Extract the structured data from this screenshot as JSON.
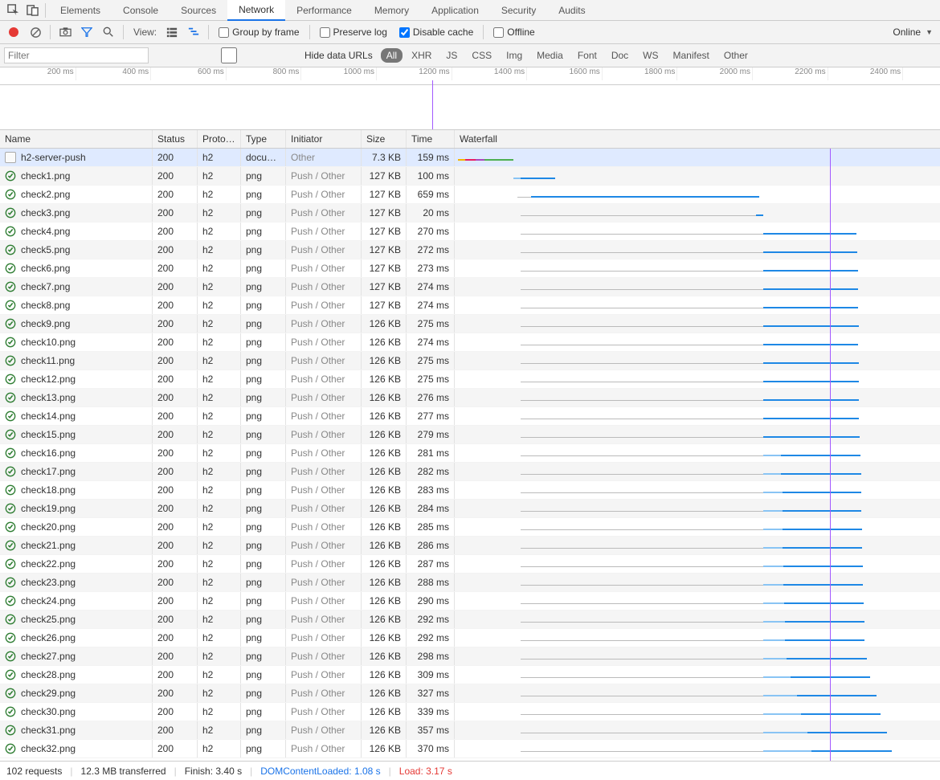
{
  "tabs": [
    "Elements",
    "Console",
    "Sources",
    "Network",
    "Performance",
    "Memory",
    "Application",
    "Security",
    "Audits"
  ],
  "active_tab": "Network",
  "toolbar": {
    "view_label": "View:",
    "group_by_frame": "Group by frame",
    "preserve_log": "Preserve log",
    "disable_cache": "Disable cache",
    "offline": "Offline",
    "online": "Online"
  },
  "filter": {
    "placeholder": "Filter",
    "hide_data_urls": "Hide data URLs",
    "types": [
      "All",
      "XHR",
      "JS",
      "CSS",
      "Img",
      "Media",
      "Font",
      "Doc",
      "WS",
      "Manifest",
      "Other"
    ],
    "active_type": "All"
  },
  "timeline_ticks": [
    "200 ms",
    "400 ms",
    "600 ms",
    "800 ms",
    "1000 ms",
    "1200 ms",
    "1400 ms",
    "1600 ms",
    "1800 ms",
    "2000 ms",
    "2200 ms",
    "2400 ms"
  ],
  "columns": [
    "Name",
    "Status",
    "Proto…",
    "Type",
    "Initiator",
    "Size",
    "Time",
    "Waterfall"
  ],
  "waterfall_max_ms": 3400,
  "dcl_ms": 1080,
  "load_ms": 3170,
  "timeline_marker_ms": 1150,
  "requests": [
    {
      "name": "h2-server-push",
      "status": "200",
      "proto": "h2",
      "type": "docu…",
      "type_full": "document",
      "initiator": "Other",
      "size": "7.3 KB",
      "time": "159 ms",
      "selected": true,
      "icon": "doc",
      "wf": {
        "start": 10,
        "wait": 0,
        "rcv": 0,
        "dl": 160,
        "style": "doc"
      }
    },
    {
      "name": "check1.png",
      "status": "200",
      "proto": "h2",
      "type": "png",
      "initiator": "Push / Other",
      "size": "127 KB",
      "time": "100 ms",
      "icon": "ok",
      "wf": {
        "start": 170,
        "wait": 0,
        "rcv": 20,
        "dl": 100
      }
    },
    {
      "name": "check2.png",
      "status": "200",
      "proto": "h2",
      "type": "png",
      "initiator": "Push / Other",
      "size": "127 KB",
      "time": "659 ms",
      "icon": "ok",
      "wf": {
        "start": 180,
        "wait": 40,
        "rcv": 0,
        "dl": 659
      }
    },
    {
      "name": "check3.png",
      "status": "200",
      "proto": "h2",
      "type": "png",
      "initiator": "Push / Other",
      "size": "127 KB",
      "time": "20 ms",
      "icon": "ok",
      "wf": {
        "start": 190,
        "wait": 680,
        "rcv": 0,
        "dl": 20
      }
    },
    {
      "name": "check4.png",
      "status": "200",
      "proto": "h2",
      "type": "png",
      "initiator": "Push / Other",
      "size": "127 KB",
      "time": "270 ms",
      "icon": "ok",
      "wf": {
        "start": 190,
        "wait": 700,
        "rcv": 0,
        "dl": 270
      }
    },
    {
      "name": "check5.png",
      "status": "200",
      "proto": "h2",
      "type": "png",
      "initiator": "Push / Other",
      "size": "127 KB",
      "time": "272 ms",
      "icon": "ok",
      "wf": {
        "start": 190,
        "wait": 700,
        "rcv": 0,
        "dl": 272
      }
    },
    {
      "name": "check6.png",
      "status": "200",
      "proto": "h2",
      "type": "png",
      "initiator": "Push / Other",
      "size": "127 KB",
      "time": "273 ms",
      "icon": "ok",
      "wf": {
        "start": 190,
        "wait": 700,
        "rcv": 0,
        "dl": 273
      }
    },
    {
      "name": "check7.png",
      "status": "200",
      "proto": "h2",
      "type": "png",
      "initiator": "Push / Other",
      "size": "127 KB",
      "time": "274 ms",
      "icon": "ok",
      "wf": {
        "start": 190,
        "wait": 700,
        "rcv": 0,
        "dl": 274
      }
    },
    {
      "name": "check8.png",
      "status": "200",
      "proto": "h2",
      "type": "png",
      "initiator": "Push / Other",
      "size": "127 KB",
      "time": "274 ms",
      "icon": "ok",
      "wf": {
        "start": 190,
        "wait": 700,
        "rcv": 0,
        "dl": 274
      }
    },
    {
      "name": "check9.png",
      "status": "200",
      "proto": "h2",
      "type": "png",
      "initiator": "Push / Other",
      "size": "126 KB",
      "time": "275 ms",
      "icon": "ok",
      "wf": {
        "start": 190,
        "wait": 700,
        "rcv": 0,
        "dl": 275
      }
    },
    {
      "name": "check10.png",
      "status": "200",
      "proto": "h2",
      "type": "png",
      "initiator": "Push / Other",
      "size": "126 KB",
      "time": "274 ms",
      "icon": "ok",
      "wf": {
        "start": 190,
        "wait": 700,
        "rcv": 0,
        "dl": 274
      }
    },
    {
      "name": "check11.png",
      "status": "200",
      "proto": "h2",
      "type": "png",
      "initiator": "Push / Other",
      "size": "126 KB",
      "time": "275 ms",
      "icon": "ok",
      "wf": {
        "start": 190,
        "wait": 700,
        "rcv": 0,
        "dl": 275
      }
    },
    {
      "name": "check12.png",
      "status": "200",
      "proto": "h2",
      "type": "png",
      "initiator": "Push / Other",
      "size": "126 KB",
      "time": "275 ms",
      "icon": "ok",
      "wf": {
        "start": 190,
        "wait": 700,
        "rcv": 0,
        "dl": 275
      }
    },
    {
      "name": "check13.png",
      "status": "200",
      "proto": "h2",
      "type": "png",
      "initiator": "Push / Other",
      "size": "126 KB",
      "time": "276 ms",
      "icon": "ok",
      "wf": {
        "start": 190,
        "wait": 700,
        "rcv": 0,
        "dl": 276
      }
    },
    {
      "name": "check14.png",
      "status": "200",
      "proto": "h2",
      "type": "png",
      "initiator": "Push / Other",
      "size": "126 KB",
      "time": "277 ms",
      "icon": "ok",
      "wf": {
        "start": 190,
        "wait": 700,
        "rcv": 0,
        "dl": 277
      }
    },
    {
      "name": "check15.png",
      "status": "200",
      "proto": "h2",
      "type": "png",
      "initiator": "Push / Other",
      "size": "126 KB",
      "time": "279 ms",
      "icon": "ok",
      "wf": {
        "start": 190,
        "wait": 700,
        "rcv": 0,
        "dl": 279
      }
    },
    {
      "name": "check16.png",
      "status": "200",
      "proto": "h2",
      "type": "png",
      "initiator": "Push / Other",
      "size": "126 KB",
      "time": "281 ms",
      "icon": "ok",
      "wf": {
        "start": 190,
        "wait": 700,
        "rcv": 50,
        "dl": 231
      }
    },
    {
      "name": "check17.png",
      "status": "200",
      "proto": "h2",
      "type": "png",
      "initiator": "Push / Other",
      "size": "126 KB",
      "time": "282 ms",
      "icon": "ok",
      "wf": {
        "start": 190,
        "wait": 700,
        "rcv": 50,
        "dl": 232
      }
    },
    {
      "name": "check18.png",
      "status": "200",
      "proto": "h2",
      "type": "png",
      "initiator": "Push / Other",
      "size": "126 KB",
      "time": "283 ms",
      "icon": "ok",
      "wf": {
        "start": 190,
        "wait": 700,
        "rcv": 55,
        "dl": 228
      }
    },
    {
      "name": "check19.png",
      "status": "200",
      "proto": "h2",
      "type": "png",
      "initiator": "Push / Other",
      "size": "126 KB",
      "time": "284 ms",
      "icon": "ok",
      "wf": {
        "start": 190,
        "wait": 700,
        "rcv": 55,
        "dl": 229
      }
    },
    {
      "name": "check20.png",
      "status": "200",
      "proto": "h2",
      "type": "png",
      "initiator": "Push / Other",
      "size": "126 KB",
      "time": "285 ms",
      "icon": "ok",
      "wf": {
        "start": 190,
        "wait": 700,
        "rcv": 55,
        "dl": 230
      }
    },
    {
      "name": "check21.png",
      "status": "200",
      "proto": "h2",
      "type": "png",
      "initiator": "Push / Other",
      "size": "126 KB",
      "time": "286 ms",
      "icon": "ok",
      "wf": {
        "start": 190,
        "wait": 700,
        "rcv": 55,
        "dl": 231
      }
    },
    {
      "name": "check22.png",
      "status": "200",
      "proto": "h2",
      "type": "png",
      "initiator": "Push / Other",
      "size": "126 KB",
      "time": "287 ms",
      "icon": "ok",
      "wf": {
        "start": 190,
        "wait": 700,
        "rcv": 58,
        "dl": 229
      }
    },
    {
      "name": "check23.png",
      "status": "200",
      "proto": "h2",
      "type": "png",
      "initiator": "Push / Other",
      "size": "126 KB",
      "time": "288 ms",
      "icon": "ok",
      "wf": {
        "start": 190,
        "wait": 700,
        "rcv": 58,
        "dl": 230
      }
    },
    {
      "name": "check24.png",
      "status": "200",
      "proto": "h2",
      "type": "png",
      "initiator": "Push / Other",
      "size": "126 KB",
      "time": "290 ms",
      "icon": "ok",
      "wf": {
        "start": 190,
        "wait": 700,
        "rcv": 60,
        "dl": 230
      }
    },
    {
      "name": "check25.png",
      "status": "200",
      "proto": "h2",
      "type": "png",
      "initiator": "Push / Other",
      "size": "126 KB",
      "time": "292 ms",
      "icon": "ok",
      "wf": {
        "start": 190,
        "wait": 700,
        "rcv": 62,
        "dl": 230
      }
    },
    {
      "name": "check26.png",
      "status": "200",
      "proto": "h2",
      "type": "png",
      "initiator": "Push / Other",
      "size": "126 KB",
      "time": "292 ms",
      "icon": "ok",
      "wf": {
        "start": 190,
        "wait": 700,
        "rcv": 62,
        "dl": 230
      }
    },
    {
      "name": "check27.png",
      "status": "200",
      "proto": "h2",
      "type": "png",
      "initiator": "Push / Other",
      "size": "126 KB",
      "time": "298 ms",
      "icon": "ok",
      "wf": {
        "start": 190,
        "wait": 700,
        "rcv": 68,
        "dl": 230
      }
    },
    {
      "name": "check28.png",
      "status": "200",
      "proto": "h2",
      "type": "png",
      "initiator": "Push / Other",
      "size": "126 KB",
      "time": "309 ms",
      "icon": "ok",
      "wf": {
        "start": 190,
        "wait": 700,
        "rcv": 79,
        "dl": 230
      }
    },
    {
      "name": "check29.png",
      "status": "200",
      "proto": "h2",
      "type": "png",
      "initiator": "Push / Other",
      "size": "126 KB",
      "time": "327 ms",
      "icon": "ok",
      "wf": {
        "start": 190,
        "wait": 700,
        "rcv": 97,
        "dl": 230
      }
    },
    {
      "name": "check30.png",
      "status": "200",
      "proto": "h2",
      "type": "png",
      "initiator": "Push / Other",
      "size": "126 KB",
      "time": "339 ms",
      "icon": "ok",
      "wf": {
        "start": 190,
        "wait": 700,
        "rcv": 109,
        "dl": 230
      }
    },
    {
      "name": "check31.png",
      "status": "200",
      "proto": "h2",
      "type": "png",
      "initiator": "Push / Other",
      "size": "126 KB",
      "time": "357 ms",
      "icon": "ok",
      "wf": {
        "start": 190,
        "wait": 700,
        "rcv": 127,
        "dl": 230
      }
    },
    {
      "name": "check32.png",
      "status": "200",
      "proto": "h2",
      "type": "png",
      "initiator": "Push / Other",
      "size": "126 KB",
      "time": "370 ms",
      "icon": "ok",
      "wf": {
        "start": 190,
        "wait": 700,
        "rcv": 140,
        "dl": 230
      }
    }
  ],
  "status": {
    "requests": "102 requests",
    "transferred": "12.3 MB transferred",
    "finish": "Finish: 3.40 s",
    "dcl": "DOMContentLoaded: 1.08 s",
    "load": "Load: 3.17 s"
  }
}
